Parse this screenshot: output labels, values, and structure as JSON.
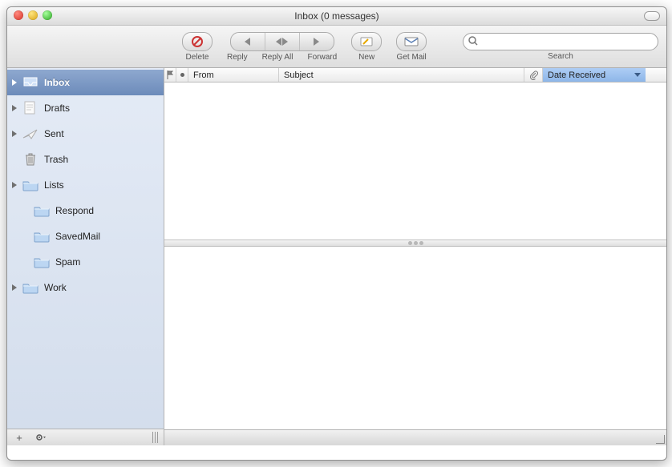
{
  "window": {
    "title": "Inbox (0 messages)"
  },
  "toolbar": {
    "delete_label": "Delete",
    "reply_label": "Reply",
    "reply_all_label": "Reply All",
    "forward_label": "Forward",
    "new_label": "New",
    "get_mail_label": "Get Mail",
    "search_label": "Search",
    "search_placeholder": ""
  },
  "columns": {
    "from": "From",
    "subject": "Subject",
    "date": "Date Received"
  },
  "sidebar": {
    "items": [
      {
        "label": "Inbox",
        "icon": "inbox",
        "expandable": true,
        "selected": true,
        "indent": 0
      },
      {
        "label": "Drafts",
        "icon": "drafts",
        "expandable": true,
        "selected": false,
        "indent": 0
      },
      {
        "label": "Sent",
        "icon": "sent",
        "expandable": true,
        "selected": false,
        "indent": 0
      },
      {
        "label": "Trash",
        "icon": "trash",
        "expandable": false,
        "selected": false,
        "indent": 0
      },
      {
        "label": "Lists",
        "icon": "folder",
        "expandable": true,
        "selected": false,
        "indent": 0
      },
      {
        "label": "Respond",
        "icon": "folder",
        "expandable": false,
        "selected": false,
        "indent": 1
      },
      {
        "label": "SavedMail",
        "icon": "folder",
        "expandable": false,
        "selected": false,
        "indent": 1
      },
      {
        "label": "Spam",
        "icon": "folder",
        "expandable": false,
        "selected": false,
        "indent": 1
      },
      {
        "label": "Work",
        "icon": "folder",
        "expandable": true,
        "selected": false,
        "indent": 0
      }
    ]
  }
}
